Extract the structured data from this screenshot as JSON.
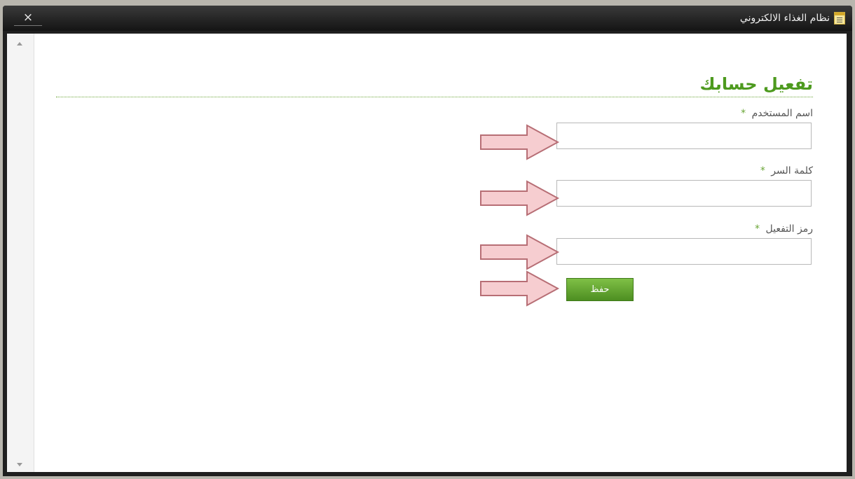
{
  "window": {
    "title": "نظام الغذاء الالكتروني",
    "close_label": "×",
    "icon": "notepad-icon"
  },
  "form": {
    "title": "تفعيل حسابك",
    "required_marker": "*",
    "fields": [
      {
        "label": "اسم المستخدم",
        "value": "",
        "placeholder": ""
      },
      {
        "label": "كلمة السر",
        "value": "",
        "placeholder": ""
      },
      {
        "label": "رمز التفعيل",
        "value": "",
        "placeholder": ""
      }
    ],
    "save_label": "حفظ"
  },
  "colors": {
    "accent_green": "#4d9a1e",
    "button_green": "#5fa82b",
    "arrow_fill": "#f6cdd0",
    "arrow_stroke": "#b76e75",
    "titlebar": "#1f1f1f"
  }
}
